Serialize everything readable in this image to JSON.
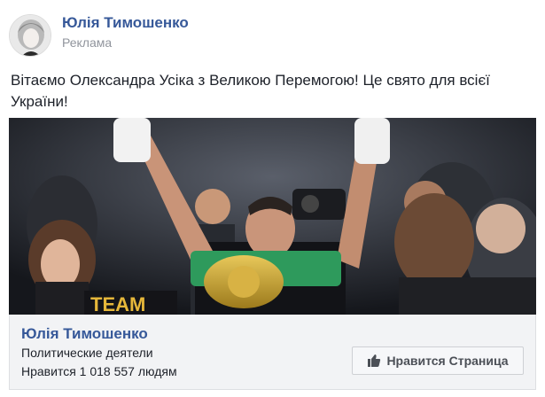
{
  "post": {
    "author": "Юлія Тимошенко",
    "sponsored_label": "Реклама",
    "text": "Вітаємо Олександра Усіка з Великою Перемогою! Це свято для всієї України!"
  },
  "media": {
    "belt_text": "TEAM",
    "icon": "boxing-champion-photo"
  },
  "page_card": {
    "name": "Юлія Тимошенко",
    "category": "Политические деятели",
    "likes": "Нравится 1 018 557 людям",
    "like_button_label": "Нравится Страница",
    "like_icon": "thumbs-up-icon"
  },
  "colors": {
    "link": "#365899",
    "secondary_text": "#90949c",
    "footer_bg": "#f2f3f5",
    "button_text": "#4b4f56"
  }
}
